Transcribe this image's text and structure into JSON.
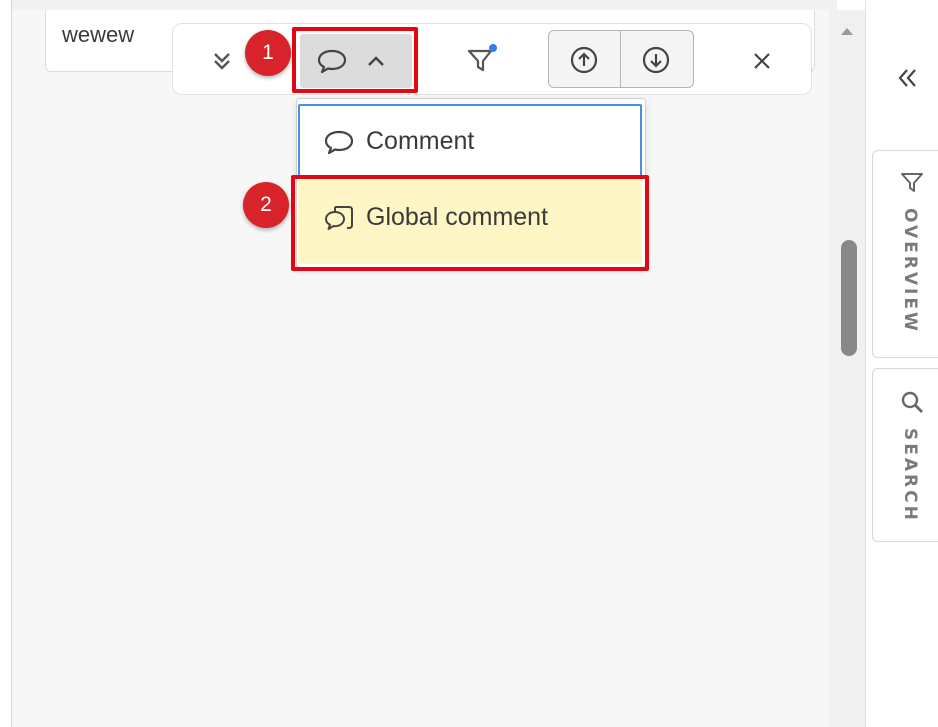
{
  "card": {
    "text": "wewew"
  },
  "toolbar": {
    "expand_icon": "double-chevron-down-icon",
    "comment_icon": "speech-bubble-icon",
    "chevron_icon": "chevron-up-icon",
    "filter_icon": "filter-icon",
    "filter_dot_color": "#2f80ed",
    "prev_icon": "arrow-up-circle-icon",
    "next_icon": "arrow-down-circle-icon",
    "close_icon": "close-icon"
  },
  "dropdown": {
    "items": [
      {
        "label": "Comment",
        "icon": "speech-bubble-icon"
      },
      {
        "label": "Global comment",
        "icon": "global-comment-icon"
      }
    ]
  },
  "callouts": {
    "step1": "1",
    "step2": "2"
  },
  "right_panel": {
    "collapse_icon": "double-chevron-left-icon",
    "tabs": [
      {
        "label": "OVERVIEW",
        "icon": "filter-icon"
      },
      {
        "label": "SEARCH",
        "icon": "search-icon"
      }
    ]
  },
  "colors": {
    "highlight_red": "#e30613",
    "badge_red": "#d8232a",
    "hover_yellow": "#fff6c5",
    "focus_blue": "#4a90e2"
  }
}
